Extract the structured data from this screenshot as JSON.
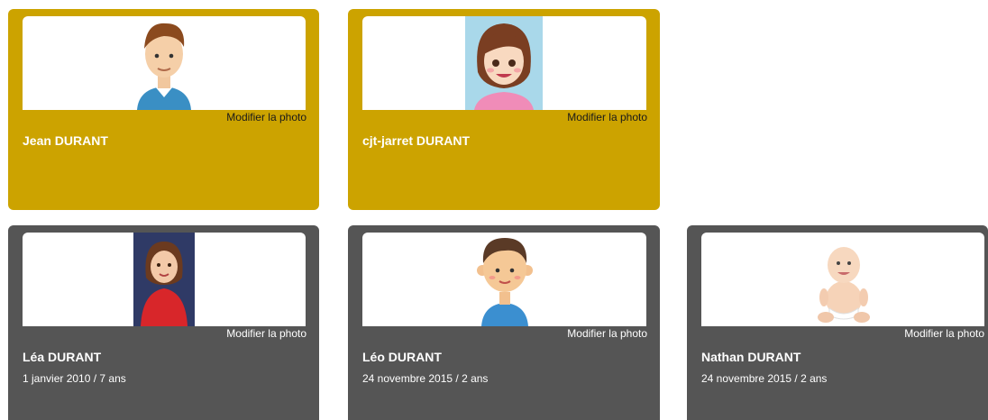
{
  "parents": [
    {
      "name": "Jean DURANT",
      "modify_label": "Modifier la photo",
      "avatar": "man-avatar"
    },
    {
      "name": "cjt-jarret DURANT",
      "modify_label": "Modifier la photo",
      "avatar": "woman-avatar"
    }
  ],
  "children": [
    {
      "name": "Léa DURANT",
      "birth": "1 janvier 2010 / 7 ans",
      "modify_label": "Modifier la photo",
      "avatar": "girl-photo"
    },
    {
      "name": "Léo DURANT",
      "birth": "24 novembre 2015 / 2 ans",
      "modify_label": "Modifier la photo",
      "avatar": "boy-avatar"
    },
    {
      "name": "Nathan DURANT",
      "birth": "24 novembre 2015 / 2 ans",
      "modify_label": "Modifier la photo",
      "avatar": "baby-photo"
    }
  ],
  "colors": {
    "parent_card": "#cca300",
    "child_card": "#555555"
  }
}
